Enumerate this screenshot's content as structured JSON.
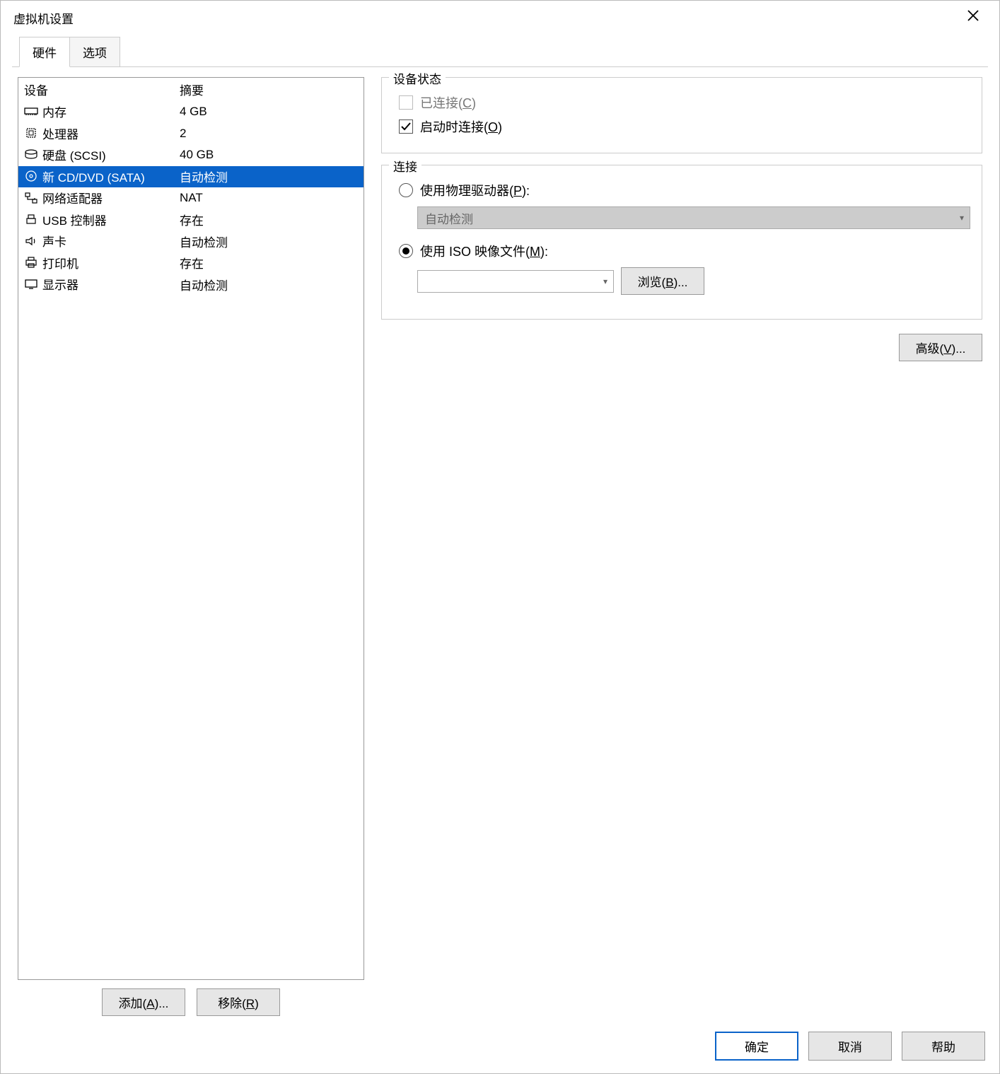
{
  "window": {
    "title": "虚拟机设置"
  },
  "tabs": {
    "hardware": "硬件",
    "options": "选项",
    "active": "hardware"
  },
  "deviceList": {
    "headers": {
      "device": "设备",
      "summary": "摘要"
    },
    "rows": [
      {
        "icon": "memory",
        "name": "内存",
        "summary": "4 GB",
        "selected": false
      },
      {
        "icon": "cpu",
        "name": "处理器",
        "summary": "2",
        "selected": false
      },
      {
        "icon": "hdd",
        "name": "硬盘 (SCSI)",
        "summary": "40 GB",
        "selected": false
      },
      {
        "icon": "cd",
        "name": "新 CD/DVD (SATA)",
        "summary": "自动检测",
        "selected": true
      },
      {
        "icon": "network",
        "name": "网络适配器",
        "summary": "NAT",
        "selected": false
      },
      {
        "icon": "usb",
        "name": "USB 控制器",
        "summary": "存在",
        "selected": false
      },
      {
        "icon": "sound",
        "name": "声卡",
        "summary": "自动检测",
        "selected": false
      },
      {
        "icon": "printer",
        "name": "打印机",
        "summary": "存在",
        "selected": false
      },
      {
        "icon": "display",
        "name": "显示器",
        "summary": "自动检测",
        "selected": false
      }
    ]
  },
  "leftButtons": {
    "add": {
      "prefix": "添加(",
      "key": "A",
      "suffix": ")..."
    },
    "remove": {
      "prefix": "移除(",
      "key": "R",
      "suffix": ")"
    }
  },
  "deviceStatus": {
    "legend": "设备状态",
    "connected": {
      "prefix": "已连接(",
      "key": "C",
      "suffix": ")",
      "checked": false,
      "disabled": true
    },
    "connectAtPowerOn": {
      "prefix": "启动时连接(",
      "key": "O",
      "suffix": ")",
      "checked": true
    }
  },
  "connection": {
    "legend": "连接",
    "physical": {
      "label_prefix": "使用物理驱动器(",
      "key": "P",
      "label_suffix": "):",
      "selected": false,
      "dropdown": "自动检测"
    },
    "iso": {
      "label_prefix": "使用 ISO 映像文件(",
      "key": "M",
      "label_suffix": "):",
      "selected": true,
      "path": "",
      "browse": {
        "prefix": "浏览(",
        "key": "B",
        "suffix": ")..."
      }
    }
  },
  "advanced": {
    "prefix": "高级(",
    "key": "V",
    "suffix": ")..."
  },
  "footer": {
    "ok": "确定",
    "cancel": "取消",
    "help": "帮助"
  }
}
